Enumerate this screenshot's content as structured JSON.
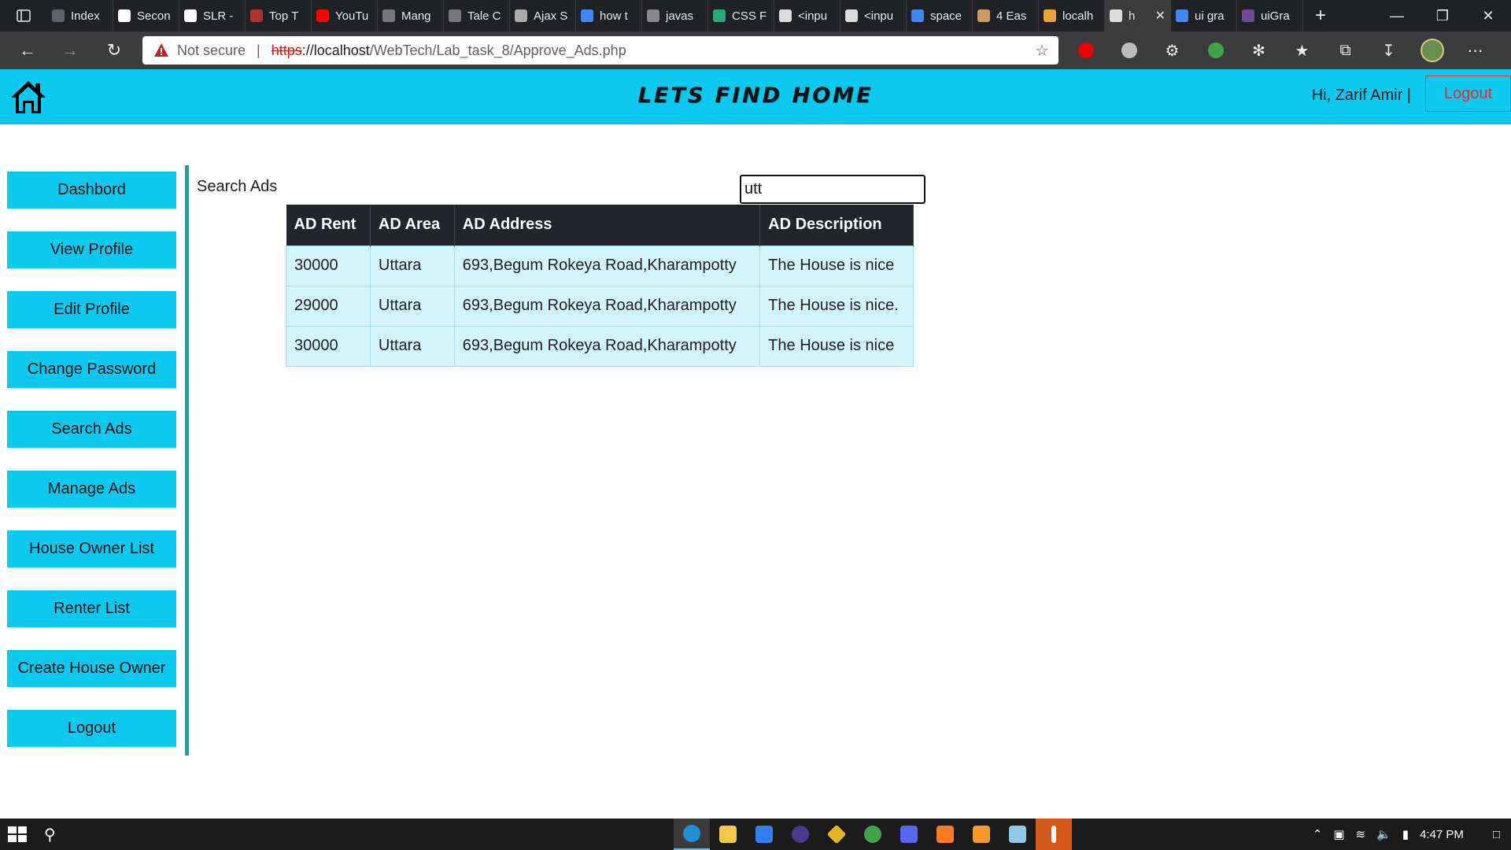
{
  "browser": {
    "tabs": [
      {
        "label": "Index",
        "color": "#5f6368"
      },
      {
        "label": "Secon",
        "color": "#ffffff"
      },
      {
        "label": "SLR -",
        "color": "#ffffff"
      },
      {
        "label": "Top T",
        "color": "#a33"
      },
      {
        "label": "YouTu",
        "color": "#ff0000"
      },
      {
        "label": "Mang",
        "color": "#777"
      },
      {
        "label": "Tale C",
        "color": "#777"
      },
      {
        "label": "Ajax S",
        "color": "#aaa"
      },
      {
        "label": "how t",
        "color": "#4285f4"
      },
      {
        "label": "javas",
        "color": "#888"
      },
      {
        "label": "CSS F",
        "color": "#2a7"
      },
      {
        "label": "<inpu",
        "color": "#ddd"
      },
      {
        "label": "<inpu",
        "color": "#ddd"
      },
      {
        "label": "space",
        "color": "#4285f4"
      },
      {
        "label": "4 Eas",
        "color": "#c96"
      },
      {
        "label": "localh",
        "color": "#e8a33d"
      },
      {
        "label": "h",
        "color": "#ddd",
        "active": true
      },
      {
        "label": "ui gra",
        "color": "#4285f4"
      },
      {
        "label": "uiGra",
        "color": "#6a4c93"
      }
    ],
    "address": {
      "not_secure": "Not secure",
      "separator": "|",
      "scheme": "https",
      "host_path": "://localhost",
      "path": "/WebTech/Lab_task_8/Approve_Ads.php"
    }
  },
  "header": {
    "logo_text": "LETS FIND HOME",
    "greeting": "Hi, Zarif Amir |",
    "logout_label": "Logout"
  },
  "sidebar": {
    "items": [
      {
        "label": "Dashbord"
      },
      {
        "label": "View Profile"
      },
      {
        "label": "Edit Profile"
      },
      {
        "label": "Change Password"
      },
      {
        "label": "Search Ads"
      },
      {
        "label": "Manage Ads"
      },
      {
        "label": "House Owner List"
      },
      {
        "label": "Renter List"
      },
      {
        "label": "Create House Owner"
      },
      {
        "label": "Logout"
      }
    ]
  },
  "main": {
    "search_label": "Search Ads",
    "search_value": "utt",
    "table": {
      "headers": [
        "AD Rent",
        "AD Area",
        "AD Address",
        "AD Description"
      ],
      "rows": [
        [
          "30000",
          "Uttara",
          "693,Begum Rokeya Road,Kharampotty",
          "The House is nice"
        ],
        [
          "29000",
          "Uttara",
          "693,Begum Rokeya Road,Kharampotty",
          "The House is nice."
        ],
        [
          "30000",
          "Uttara",
          "693,Begum Rokeya Road,Kharampotty",
          "The House is nice"
        ]
      ]
    }
  },
  "taskbar": {
    "time": "4:47 PM",
    "accent_color": "#0dc9ef"
  }
}
